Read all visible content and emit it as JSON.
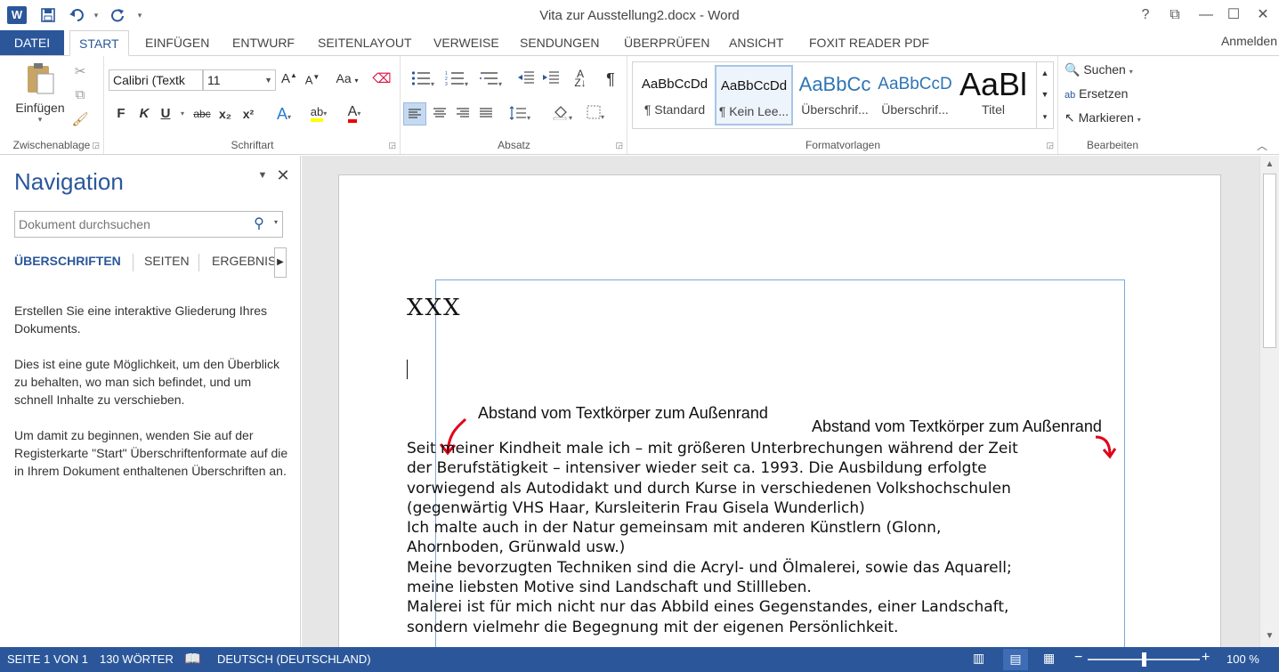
{
  "window": {
    "title": "Vita zur Ausstellung2.docx - Word",
    "app_badge": "W",
    "controls": {
      "help": "?",
      "ribbon_opts": "⧉",
      "minimize": "—",
      "maximize": "☐",
      "close": "✕"
    }
  },
  "quick_access": {
    "save_icon": "💾",
    "undo_icon": "↶",
    "redo_icon": "↻",
    "customize_icon": "▾"
  },
  "tabs": {
    "datei": "DATEI",
    "start": "START",
    "einfuegen": "EINFÜGEN",
    "entwurf": "ENTWURF",
    "seitenlayout": "SEITENLAYOUT",
    "verweise": "VERWEISE",
    "sendungen": "SENDUNGEN",
    "ueberpruefen": "ÜBERPRÜFEN",
    "ansicht": "ANSICHT",
    "foxit": "FOXIT READER PDF"
  },
  "signin": "Anmelden",
  "ribbon": {
    "clipboard": {
      "label": "Zwischenablage",
      "paste": "Einfügen"
    },
    "font": {
      "label": "Schriftart",
      "font_name": "Calibri (Textk",
      "font_size": "11",
      "bold": "F",
      "italic": "K",
      "underline": "U",
      "strike": "abc",
      "sub": "x₂",
      "sup": "x²",
      "grow": "A",
      "shrink": "A",
      "case": "Aa",
      "highlight": "ab",
      "color": "A"
    },
    "paragraph": {
      "label": "Absatz",
      "pilcrow": "¶"
    },
    "styles": {
      "label": "Formatvorlagen",
      "items": [
        {
          "preview": "AaBbCcDd",
          "name": "¶ Standard"
        },
        {
          "preview": "AaBbCcDd",
          "name": "¶ Kein Lee..."
        },
        {
          "preview": "AaBbCc",
          "name": "Überschrif..."
        },
        {
          "preview": "AaBbCcD",
          "name": "Überschrif..."
        },
        {
          "preview": "AaBl",
          "name": "Titel"
        }
      ]
    },
    "editing": {
      "label": "Bearbeiten",
      "find": "Suchen",
      "replace": "Ersetzen",
      "select": "Markieren"
    }
  },
  "navigation": {
    "title": "Navigation",
    "search_placeholder": "Dokument durchsuchen",
    "tabs": {
      "headings": "ÜBERSCHRIFTEN",
      "pages": "SEITEN",
      "results": "ERGEBNISSE"
    },
    "paragraphs": [
      "Erstellen Sie eine interaktive Gliederung Ihres Dokuments.",
      "Dies ist eine gute Möglichkeit, um den Überblick zu behalten, wo man sich befindet, und um schnell Inhalte zu verschieben.",
      "Um damit zu beginnen, wenden Sie auf der Registerkarte \"Start\" Überschriftenformate auf die in Ihrem Dokument enthaltenen Überschriften an."
    ]
  },
  "document": {
    "heading": "XXX",
    "annotation_left": "Abstand vom Textkörper zum Außenrand",
    "annotation_right": "Abstand vom Textkörper zum Außenrand",
    "lines": [
      "Seit meiner Kindheit male ich – mit größeren Unterbrechungen während der Zeit",
      "der Berufstätigkeit – intensiver wieder seit ca. 1993. Die Ausbildung erfolgte",
      "vorwiegend als Autodidakt und durch Kurse in verschiedenen Volkshochschulen",
      "(gegenwärtig VHS Haar, Kursleiterin Frau Gisela Wunderlich)",
      "Ich malte auch in der Natur gemeinsam mit anderen Künstlern (Glonn,",
      "Ahornboden, Grünwald usw.)",
      "Meine bevorzugten Techniken sind die Acryl- und Ölmalerei, sowie das Aquarell;",
      "meine liebsten Motive sind Landschaft und Stillleben.",
      "Malerei ist für mich nicht nur das Abbild eines Gegenstandes, einer Landschaft,",
      "sondern vielmehr die Begegnung mit der eigenen Persönlichkeit."
    ]
  },
  "status": {
    "page": "SEITE 1 VON 1",
    "words": "130 WÖRTER",
    "language": "DEUTSCH (DEUTSCHLAND)",
    "zoom": "100 %",
    "zoom_fraction": 0.5
  },
  "colors": {
    "accent": "#2b579a",
    "annotation_arrow": "#e0001b"
  }
}
